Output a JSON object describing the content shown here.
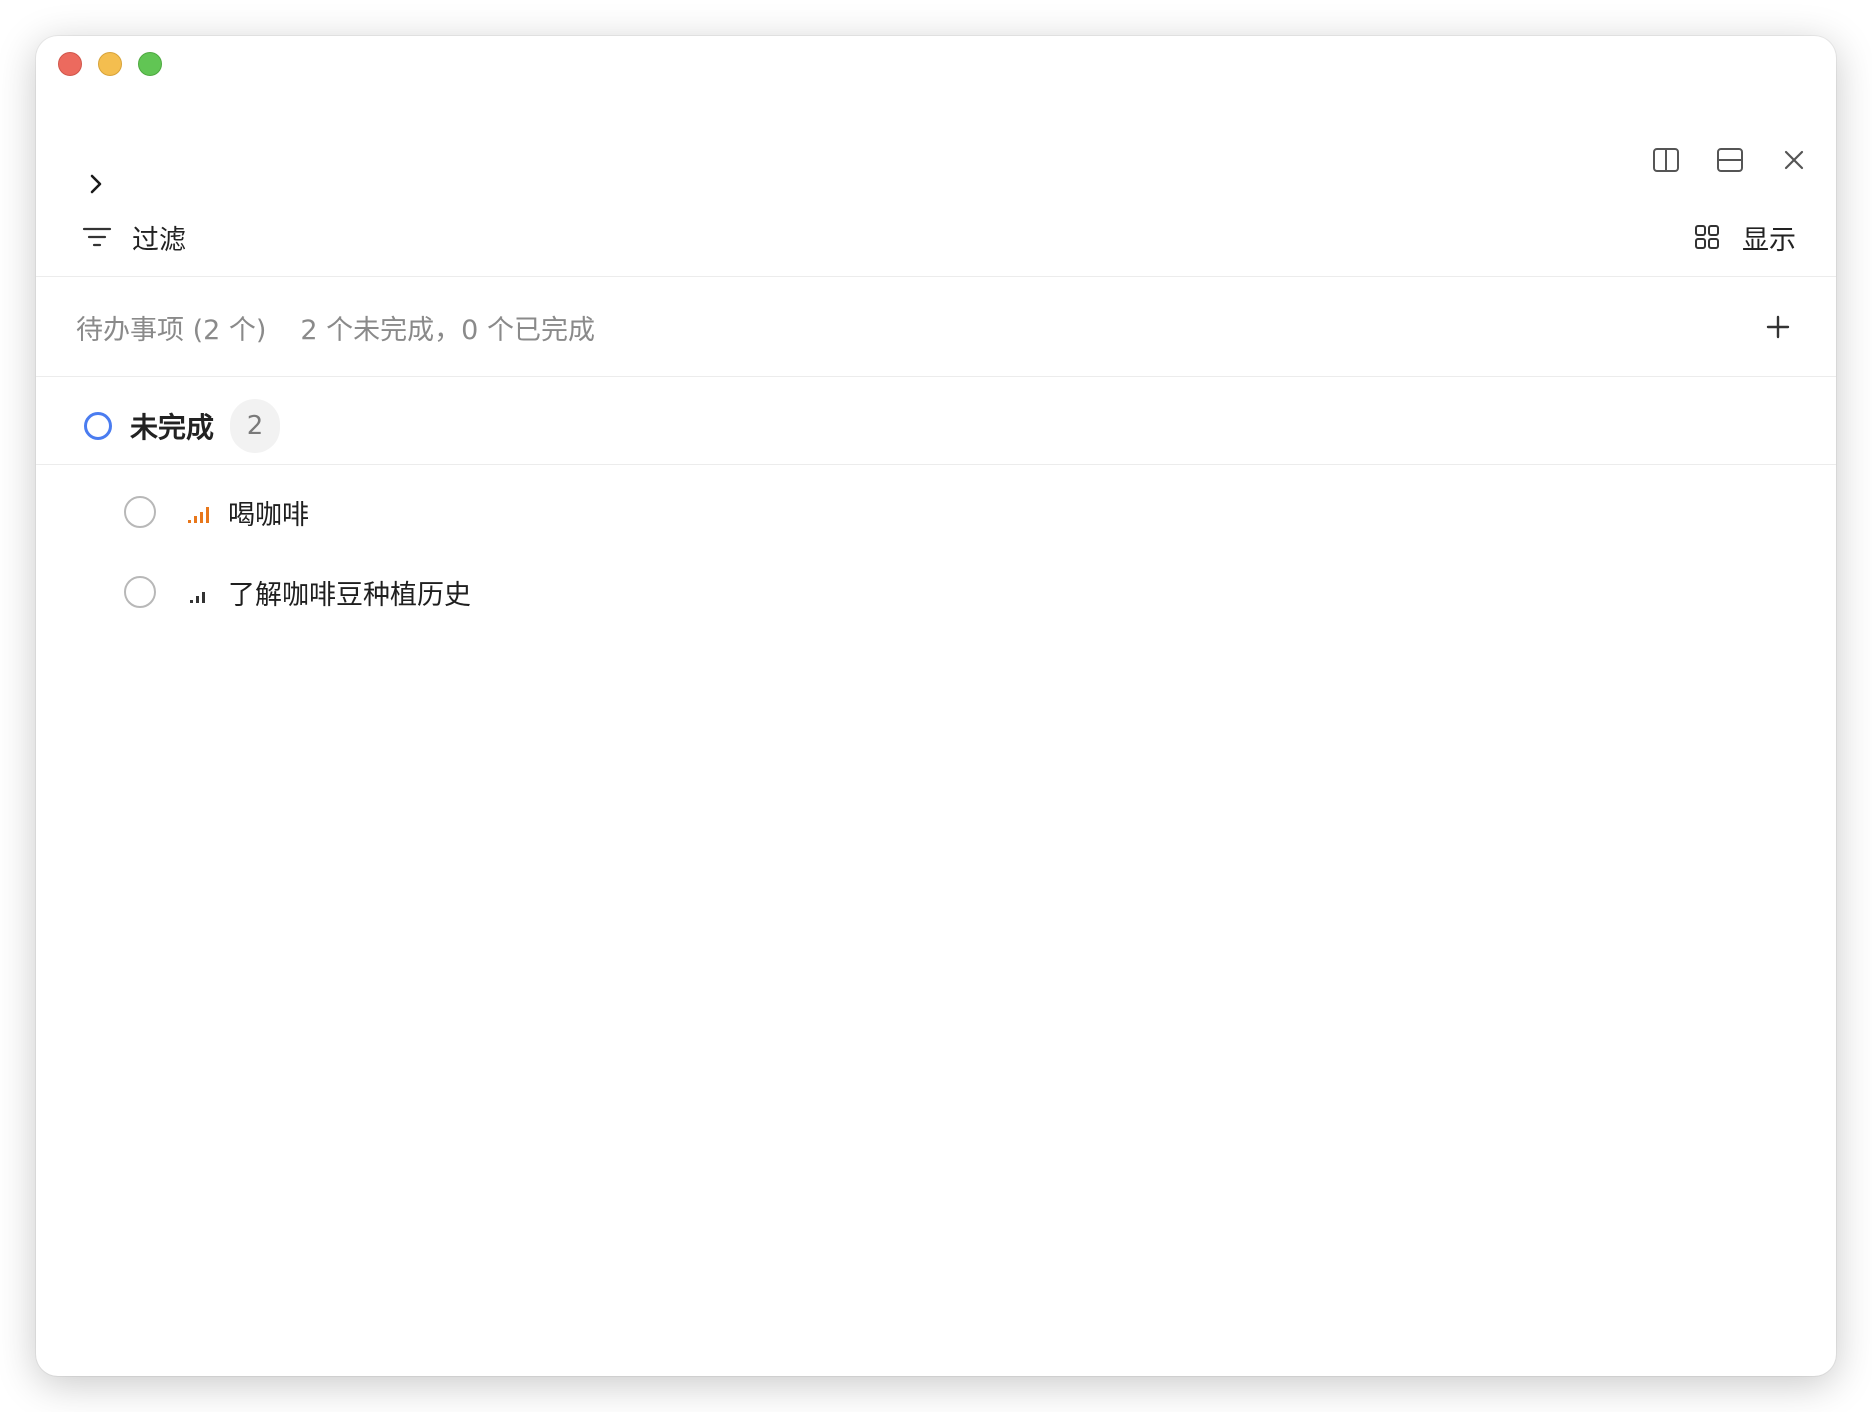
{
  "toolbar": {
    "filter_label": "过滤",
    "display_label": "显示"
  },
  "summary": {
    "title": "待办事项 (2 个)",
    "stats": "2 个未完成，0 个已完成"
  },
  "group": {
    "label": "未完成",
    "count": "2"
  },
  "tasks": [
    {
      "title": "喝咖啡",
      "priority": "medium",
      "priority_color": "#e8771b"
    },
    {
      "title": "了解咖啡豆种植历史",
      "priority": "low",
      "priority_color": "#333333"
    }
  ],
  "colors": {
    "accent_blue": "#4a7cf0",
    "priority_medium": "#e8771b"
  },
  "icons": {
    "expand": "chevron-right-icon",
    "split_vertical": "split-vertical-icon",
    "split_horizontal": "split-horizontal-icon",
    "close": "close-icon",
    "filter": "filter-icon",
    "display": "grid-icon",
    "add": "plus-icon"
  }
}
